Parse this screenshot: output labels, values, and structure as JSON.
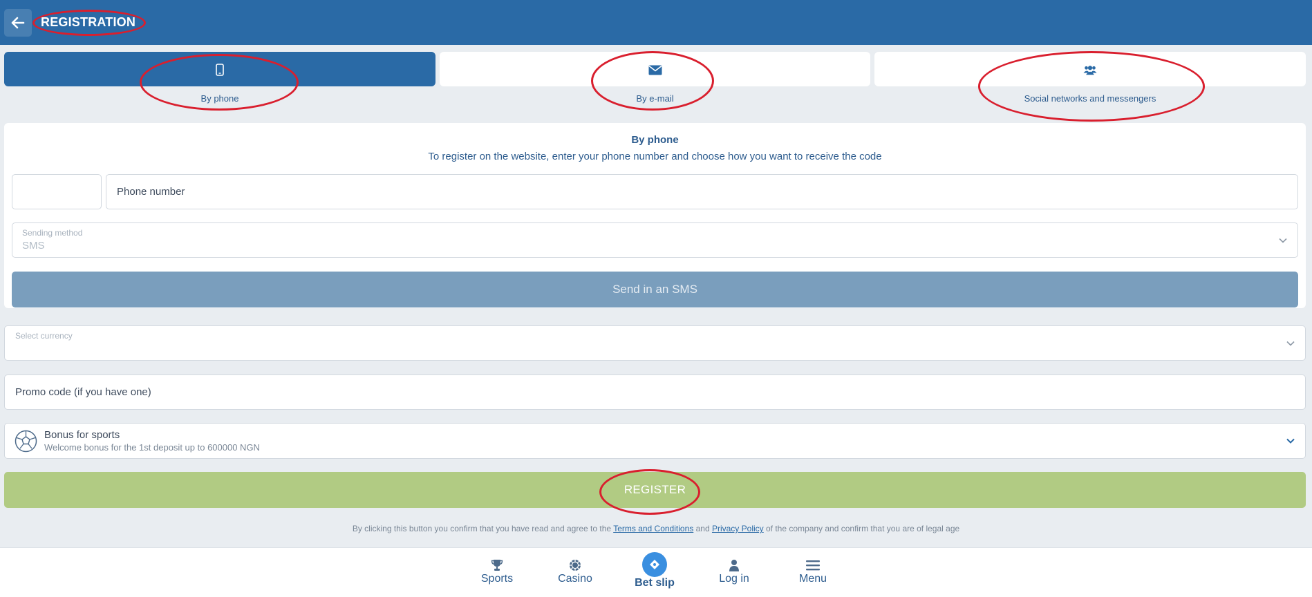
{
  "header": {
    "title": "REGISTRATION"
  },
  "tabs": [
    {
      "label": "By phone",
      "icon": "mobile-phone-icon",
      "active": true
    },
    {
      "label": "By e-mail",
      "icon": "envelope-icon",
      "active": false
    },
    {
      "label": "Social networks and messengers",
      "icon": "users-icon",
      "active": false
    }
  ],
  "phone_form": {
    "title": "By phone",
    "description": "To register on the website, enter your phone number and choose how you want to receive the code",
    "country_code_value": "",
    "phone_placeholder": "Phone number",
    "sending_method_label": "Sending method",
    "sending_method_value": "SMS",
    "send_button": "Send in an SMS"
  },
  "currency": {
    "label": "Select currency",
    "value": ""
  },
  "promo": {
    "placeholder": "Promo code (if you have one)"
  },
  "bonus": {
    "title": "Bonus for sports",
    "subtitle": "Welcome bonus for the 1st deposit up to 600000 NGN",
    "icon": "soccer-ball-icon"
  },
  "register_button": "REGISTER",
  "legal": {
    "prefix": "By clicking this button you confirm that you have read and agree to the",
    "terms": "Terms and Conditions",
    "and": "and",
    "privacy": "Privacy Policy",
    "suffix": "of the company and confirm that you are of legal age"
  },
  "bottom_nav": [
    {
      "label": "Sports",
      "icon": "trophy-icon"
    },
    {
      "label": "Casino",
      "icon": "casino-chip-icon"
    },
    {
      "label": "Bet slip",
      "icon": "ticket-icon",
      "active": true
    },
    {
      "label": "Log in",
      "icon": "user-icon"
    },
    {
      "label": "Menu",
      "icon": "hamburger-menu-icon"
    }
  ],
  "colors": {
    "header": "#2a6aa6",
    "active_tab": "#2a6aa6",
    "send_button": "#7a9ebd",
    "register_button": "#b1cb83",
    "annotation": "#d91f2e"
  }
}
